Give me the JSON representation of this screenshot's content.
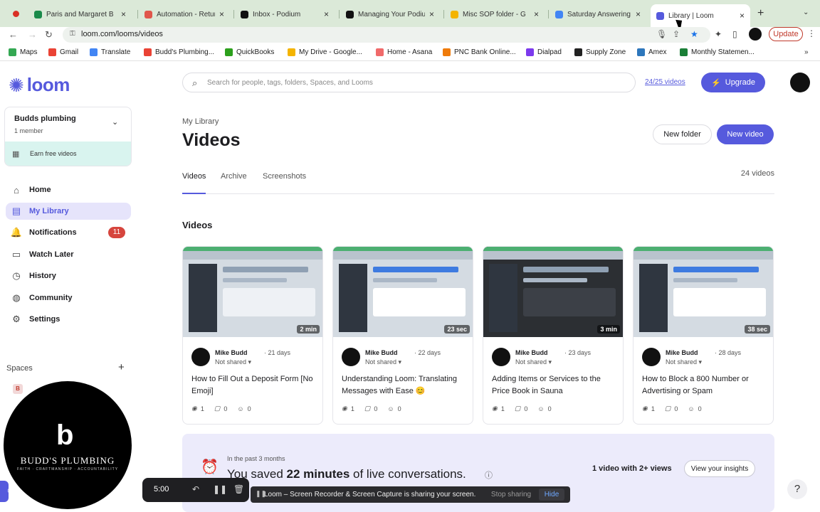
{
  "browser": {
    "tabs": [
      {
        "title": "Paris and Margaret B",
        "color": "#1a8a4a"
      },
      {
        "title": "Automation - Return",
        "color": "#e0564b"
      },
      {
        "title": "Inbox - Podium",
        "color": "#111111"
      },
      {
        "title": "Managing Your Podiu",
        "color": "#111111"
      },
      {
        "title": "Misc SOP folder - G",
        "color": "#f4b400"
      },
      {
        "title": "Saturday Answering",
        "color": "#4285f4"
      },
      {
        "title": "Library | Loom",
        "color": "#565add"
      }
    ],
    "url": "loom.com/looms/videos",
    "update_label": "Update",
    "new_tab": "+",
    "bookmarks": [
      {
        "label": "Maps",
        "color": "#34a853"
      },
      {
        "label": "Gmail",
        "color": "#ea4335"
      },
      {
        "label": "Translate",
        "color": "#4285f4"
      },
      {
        "label": "Budd's Plumbing...",
        "color": "#ea4335"
      },
      {
        "label": "QuickBooks",
        "color": "#2ca01c"
      },
      {
        "label": "My Drive - Google...",
        "color": "#f4b400"
      },
      {
        "label": "Home - Asana",
        "color": "#f06a6a"
      },
      {
        "label": "PNC Bank Online...",
        "color": "#ef7b0a"
      },
      {
        "label": "Dialpad",
        "color": "#7c3aed"
      },
      {
        "label": "Supply Zone",
        "color": "#222222"
      },
      {
        "label": "Amex",
        "color": "#2e77bc"
      },
      {
        "label": "Monthly Statemen...",
        "color": "#1a7f37"
      }
    ],
    "bookmarks_more": "»"
  },
  "sidebar": {
    "logo_text": "loom",
    "workspace": {
      "name": "Budds plumbing",
      "members": "1 member",
      "earn": "Earn free videos"
    },
    "nav": [
      {
        "label": "Home",
        "icon": "⌂",
        "icon_name": "home-icon"
      },
      {
        "label": "My Library",
        "icon": "▤",
        "icon_name": "library-icon",
        "active": true
      },
      {
        "label": "Notifications",
        "icon": "🔔",
        "icon_name": "bell-icon",
        "badge": "11"
      },
      {
        "label": "Watch Later",
        "icon": "▭",
        "icon_name": "watch-later-icon"
      },
      {
        "label": "History",
        "icon": "◷",
        "icon_name": "history-icon"
      },
      {
        "label": "Community",
        "icon": "◍",
        "icon_name": "community-icon"
      },
      {
        "label": "Settings",
        "icon": "⚙",
        "icon_name": "gear-icon"
      }
    ],
    "spaces_label": "Spaces",
    "space_initial": "B"
  },
  "header": {
    "search_placeholder": "Search for people, tags, folders, Spaces, and Looms",
    "quota": "24/25 videos",
    "upgrade": "Upgrade"
  },
  "page": {
    "breadcrumb": "My Library",
    "title": "Videos",
    "new_folder": "New folder",
    "new_video": "New video",
    "tabs": [
      "Videos",
      "Archive",
      "Screenshots"
    ],
    "count": "24 videos",
    "section": "Videos"
  },
  "videos": [
    {
      "duration": "2 min",
      "author": "Mike Budd",
      "days": "· 21 days",
      "share": "Not shared ▾",
      "title": "How to Fill Out a Deposit Form [No Emoji]",
      "views": "1",
      "comments": "0",
      "reactions": "0",
      "theme": "light"
    },
    {
      "duration": "23 sec",
      "author": "Mike Budd",
      "days": "· 22 days",
      "share": "Not shared ▾",
      "title": "Understanding Loom: Translating Messages with Ease 😊",
      "views": "1",
      "comments": "0",
      "reactions": "0",
      "theme": "blue"
    },
    {
      "duration": "3 min",
      "author": "Mike Budd",
      "days": "· 23 days",
      "share": "Not shared ▾",
      "title": "Adding Items or Services to the Price Book in Sauna",
      "views": "1",
      "comments": "0",
      "reactions": "0",
      "theme": "dark"
    },
    {
      "duration": "38 sec",
      "author": "Mike Budd",
      "days": "· 28 days",
      "share": "Not shared ▾",
      "title": "How to Block a 800 Number or Advertising or Spam",
      "views": "1",
      "comments": "0",
      "reactions": "0",
      "theme": "blue"
    }
  ],
  "banner": {
    "small": "In the past 3 months",
    "prefix": "You saved ",
    "highlight": "22 minutes",
    "suffix": " of live conversations.",
    "metric": "1 video with 2+ views",
    "button": "View your insights"
  },
  "camera": {
    "brand": "BUDD'S PLUMBING",
    "sub": "FAITH · CRAFTMANSHIP · ACCOUNTABILITY"
  },
  "recorder": {
    "time": "5:00"
  },
  "share_bar": {
    "text": "Loom – Screen Recorder & Screen Capture is sharing your screen.",
    "stop": "Stop sharing",
    "hide": "Hide"
  },
  "help": "?"
}
